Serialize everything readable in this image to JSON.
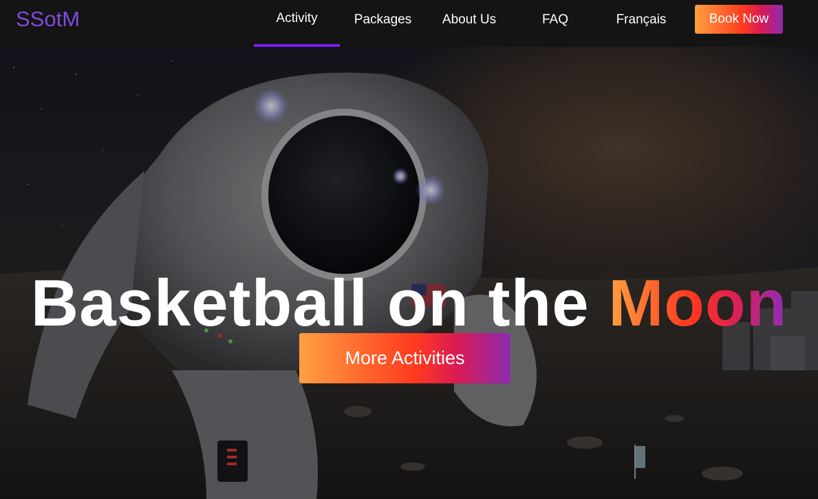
{
  "brand": {
    "logo_text": "SSotM"
  },
  "nav": {
    "items": [
      {
        "label": "Activity",
        "active": true
      },
      {
        "label": "Packages",
        "active": false
      },
      {
        "label": "About Us",
        "active": false
      },
      {
        "label": "FAQ",
        "active": false
      },
      {
        "label": "Français",
        "active": false
      }
    ],
    "cta_label": "Book Now"
  },
  "hero": {
    "title_main": "Basketball on the",
    "title_highlight": "Moon",
    "button_label": "More Activities",
    "background_description_icon": "astronaut-on-moon-photo"
  },
  "colors": {
    "nav_background": "#141414",
    "logo": "#7c4ddf",
    "active_underline": "#7a1ff0",
    "gradient": [
      "#ffa040",
      "#ff3a1f",
      "#d81a55",
      "#8c2bb0"
    ]
  }
}
